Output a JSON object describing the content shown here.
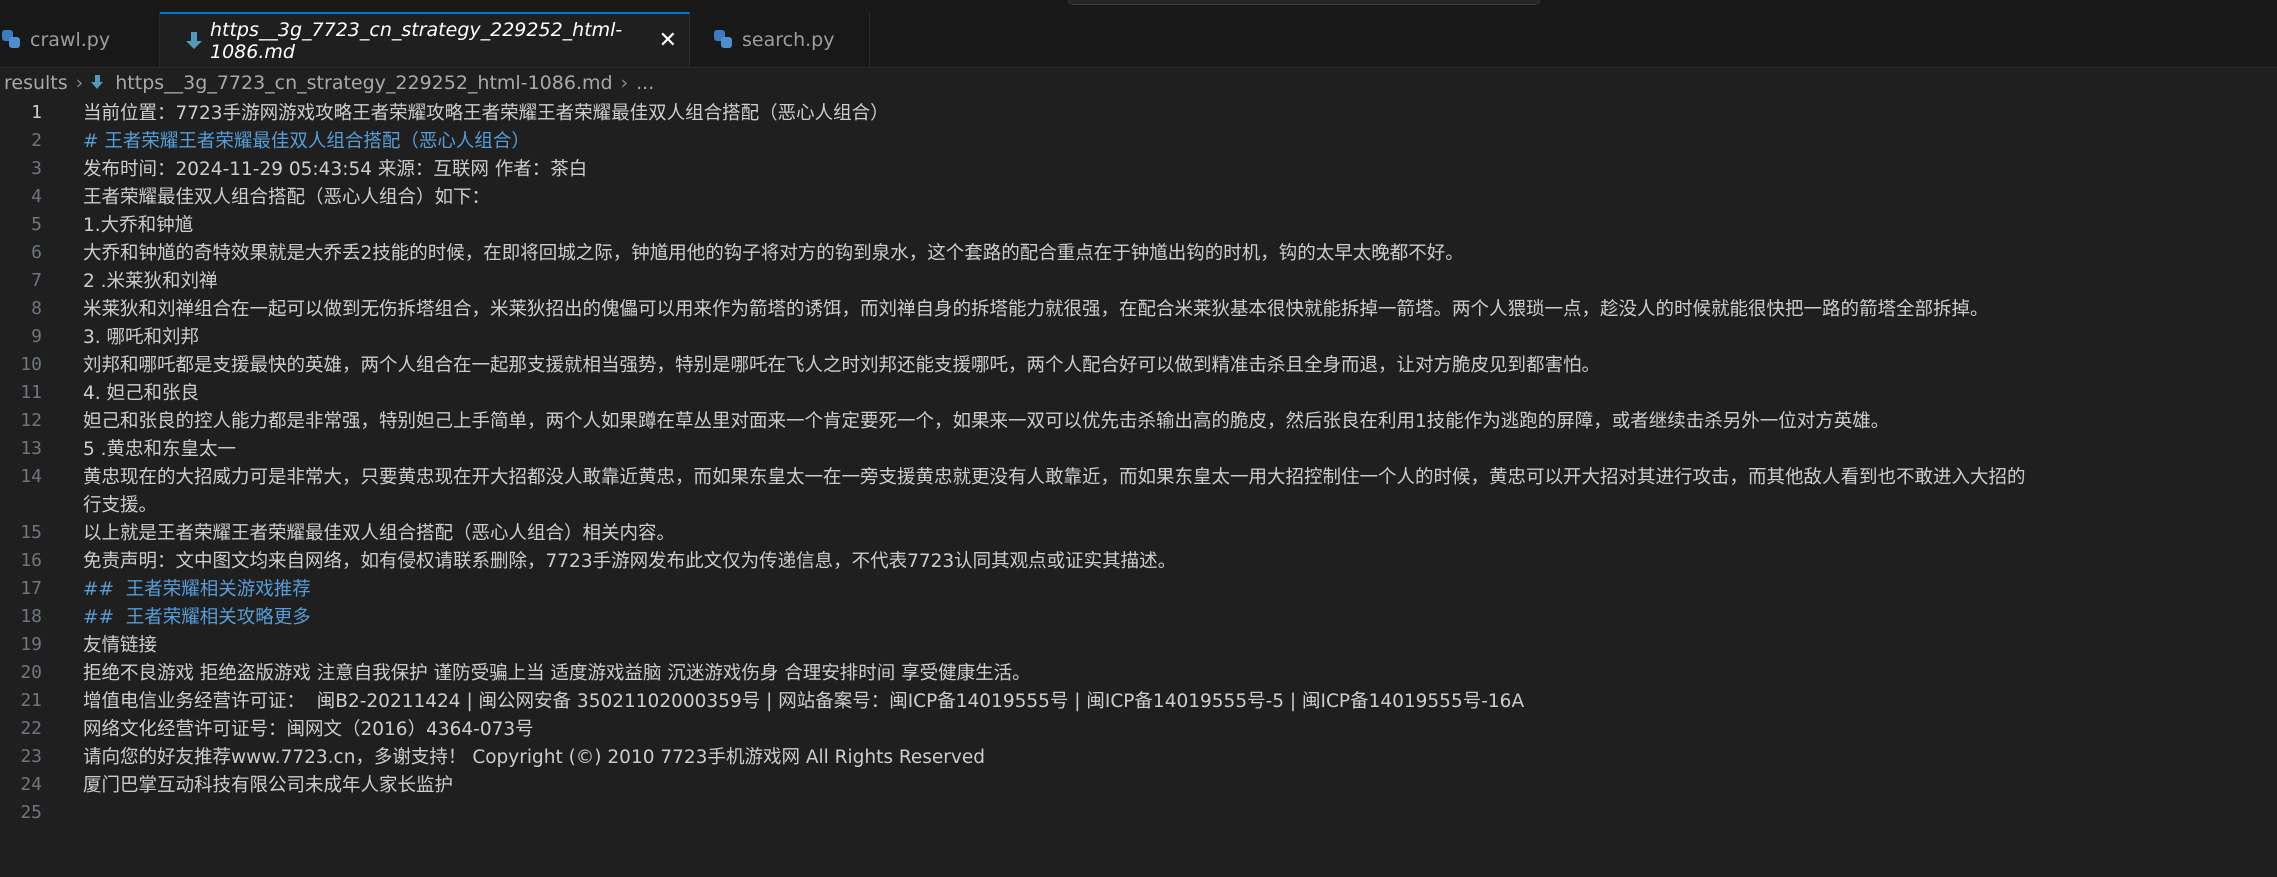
{
  "tabs": [
    {
      "label": "crawl.py",
      "icon": "python-icon"
    },
    {
      "label": "https__3g_7723_cn_strategy_229252_html-1086.md",
      "icon": "markdown-icon",
      "close": "✕"
    },
    {
      "label": "search.py",
      "icon": "python-icon"
    }
  ],
  "breadcrumb": {
    "root": "results",
    "file": "https__3g_7723_cn_strategy_229252_html-1086.md",
    "tail": "..."
  },
  "lines": [
    {
      "n": "1",
      "text": "当前位置：7723手游网游戏攻略王者荣耀攻略王者荣耀王者荣耀最佳双人组合搭配（恶心人组合）"
    },
    {
      "n": "2",
      "text": "# 王者荣耀王者荣耀最佳双人组合搭配（恶心人组合）"
    },
    {
      "n": "3",
      "text": "发布时间：2024-11-29 05:43:54 来源：互联网 作者：茶白"
    },
    {
      "n": "4",
      "text": "王者荣耀最佳双人组合搭配（恶心人组合）如下："
    },
    {
      "n": "5",
      "text": "1.大乔和钟馗"
    },
    {
      "n": "6",
      "text": "大乔和钟馗的奇特效果就是大乔丢2技能的时候，在即将回城之际，钟馗用他的钩子将对方的钩到泉水，这个套路的配合重点在于钟馗出钩的时机，钩的太早太晚都不好。"
    },
    {
      "n": "7",
      "text": "2 .米莱狄和刘禅"
    },
    {
      "n": "8",
      "text": "米莱狄和刘禅组合在一起可以做到无伤拆塔组合，米莱狄招出的傀儡可以用来作为箭塔的诱饵，而刘禅自身的拆塔能力就很强，在配合米莱狄基本很快就能拆掉一箭塔。两个人猥琐一点，趁没人的时候就能很快把一路的箭塔全部拆掉。"
    },
    {
      "n": "9",
      "text": "3. 哪吒和刘邦"
    },
    {
      "n": "10",
      "text": "刘邦和哪吒都是支援最快的英雄，两个人组合在一起那支援就相当强势，特别是哪吒在飞人之时刘邦还能支援哪吒，两个人配合好可以做到精准击杀且全身而退，让对方脆皮见到都害怕。"
    },
    {
      "n": "11",
      "text": "4. 妲己和张良"
    },
    {
      "n": "12",
      "text": "妲己和张良的控人能力都是非常强，特别妲己上手简单，两个人如果蹲在草丛里对面来一个肯定要死一个，如果来一双可以优先击杀输出高的脆皮，然后张良在利用1技能作为逃跑的屏障，或者继续击杀另外一位对方英雄。"
    },
    {
      "n": "13",
      "text": "5 .黄忠和东皇太一"
    },
    {
      "n": "14",
      "text": "黄忠现在的大招威力可是非常大，只要黄忠现在开大招都没人敢靠近黄忠，而如果东皇太一在一旁支援黄忠就更没有人敢靠近，而如果东皇太一用大招控制住一个人的时候，黄忠可以开大招对其进行攻击，而其他敌人看到也不敢进入大招的",
      "wrap": "行支援。"
    },
    {
      "n": "15",
      "text": "以上就是王者荣耀王者荣耀最佳双人组合搭配（恶心人组合）相关内容。"
    },
    {
      "n": "16",
      "text": "免责声明：文中图文均来自网络，如有侵权请联系删除，7723手游网发布此文仅为传递信息，不代表7723认同其观点或证实其描述。"
    },
    {
      "n": "17",
      "text": "##  王者荣耀相关游戏推荐"
    },
    {
      "n": "18",
      "text": "##  王者荣耀相关攻略更多"
    },
    {
      "n": "19",
      "text": "友情链接"
    },
    {
      "n": "20",
      "text": "拒绝不良游戏 拒绝盗版游戏 注意自我保护 谨防受骗上当 适度游戏益脑 沉迷游戏伤身 合理安排时间 享受健康生活。"
    },
    {
      "n": "21",
      "text": "增值电信业务经营许可证：  闽B2-20211424 | 闽公网安备 35021102000359号 | 网站备案号：闽ICP备14019555号 | 闽ICP备14019555号-5 | 闽ICP备14019555号-16A"
    },
    {
      "n": "22",
      "text": "网络文化经营许可证号：闽网文（2016）4364-073号"
    },
    {
      "n": "23",
      "text": "请向您的好友推荐www.7723.cn，多谢支持！ Copyright (©) 2010 7723手机游戏网 All Rights Reserved"
    },
    {
      "n": "24",
      "text": "厦门巴掌互动科技有限公司未成年人家长监护"
    },
    {
      "n": "25",
      "text": ""
    }
  ]
}
